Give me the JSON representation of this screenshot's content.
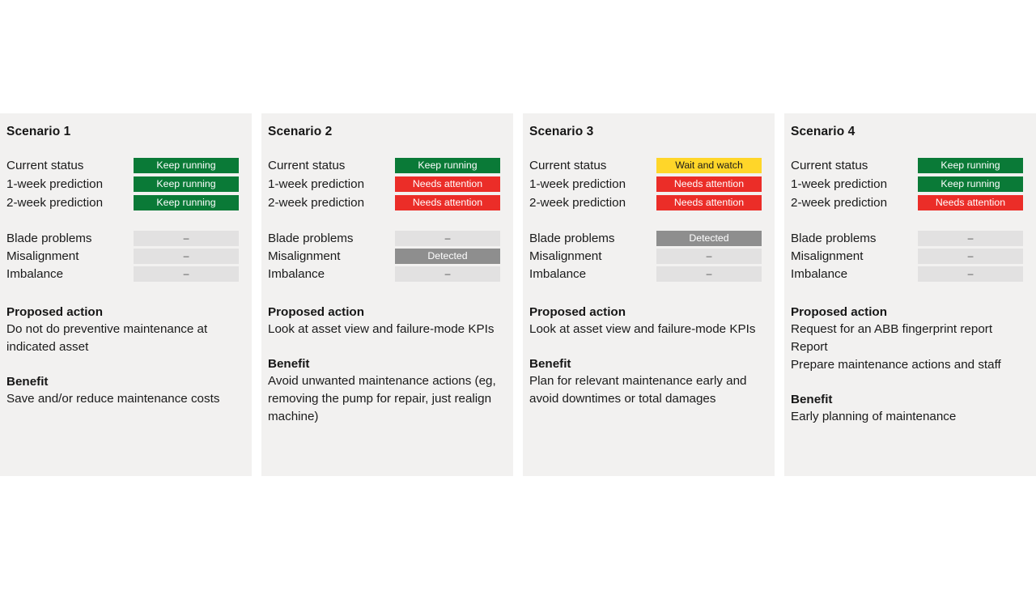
{
  "labels": {
    "status_rows": [
      "Current status",
      "1-week prediction",
      "2-week prediction"
    ],
    "fault_rows": [
      "Blade problems",
      "Misalignment",
      "Imbalance"
    ],
    "proposed_action_heading": "Proposed action",
    "benefit_heading": "Benefit"
  },
  "colors": {
    "keep_running": "#0a7a37",
    "needs_attention": "#eb2d28",
    "wait_and_watch": "#ffd629",
    "detected": "#8e8e8e",
    "none": "#e2e1e1",
    "card_background": "#f2f1f0",
    "page_background": "#ffffff"
  },
  "cards": [
    {
      "title": "Scenario 1",
      "status": [
        {
          "label": "Current status",
          "value": "Keep running",
          "state": "green"
        },
        {
          "label": "1-week prediction",
          "value": "Keep running",
          "state": "green"
        },
        {
          "label": "2-week prediction",
          "value": "Keep running",
          "state": "green"
        }
      ],
      "faults": [
        {
          "label": "Blade problems",
          "value": "–",
          "state": "gray"
        },
        {
          "label": "Misalignment",
          "value": "–",
          "state": "gray"
        },
        {
          "label": "Imbalance",
          "value": "–",
          "state": "gray"
        }
      ],
      "proposed_action_heading": "Proposed action",
      "proposed_action": "Do not do preventive maintenance at indicated asset",
      "benefit_heading": "Benefit",
      "benefit": "Save and/or reduce maintenance costs"
    },
    {
      "title": "Scenario 2",
      "status": [
        {
          "label": "Current status",
          "value": "Keep running",
          "state": "green"
        },
        {
          "label": "1-week prediction",
          "value": "Needs attention",
          "state": "red"
        },
        {
          "label": "2-week prediction",
          "value": "Needs attention",
          "state": "red"
        }
      ],
      "faults": [
        {
          "label": "Blade problems",
          "value": "–",
          "state": "gray"
        },
        {
          "label": "Misalignment",
          "value": "Detected",
          "state": "darkgray"
        },
        {
          "label": "Imbalance",
          "value": "–",
          "state": "gray"
        }
      ],
      "proposed_action_heading": "Proposed action",
      "proposed_action": "Look at asset view and failure-mode KPIs",
      "benefit_heading": "Benefit",
      "benefit": "Avoid unwanted maintenance actions (eg, removing the pump for repair, just realign machine)"
    },
    {
      "title": "Scenario 3",
      "status": [
        {
          "label": "Current status",
          "value": "Wait and watch",
          "state": "yellow"
        },
        {
          "label": "1-week prediction",
          "value": "Needs attention",
          "state": "red"
        },
        {
          "label": "2-week prediction",
          "value": "Needs attention",
          "state": "red"
        }
      ],
      "faults": [
        {
          "label": "Blade problems",
          "value": "Detected",
          "state": "darkgray"
        },
        {
          "label": "Misalignment",
          "value": "–",
          "state": "gray"
        },
        {
          "label": "Imbalance",
          "value": "–",
          "state": "gray"
        }
      ],
      "proposed_action_heading": "Proposed action",
      "proposed_action": "Look at asset view and failure-mode KPIs",
      "benefit_heading": "Benefit",
      "benefit": "Plan for relevant maintenance early and avoid downtimes or total damages"
    },
    {
      "title": "Scenario 4",
      "status": [
        {
          "label": "Current status",
          "value": "Keep running",
          "state": "green"
        },
        {
          "label": "1-week prediction",
          "value": "Keep running",
          "state": "green"
        },
        {
          "label": "2-week prediction",
          "value": "Needs attention",
          "state": "red"
        }
      ],
      "faults": [
        {
          "label": "Blade problems",
          "value": "–",
          "state": "gray"
        },
        {
          "label": "Misalignment",
          "value": "–",
          "state": "gray"
        },
        {
          "label": "Imbalance",
          "value": "–",
          "state": "gray"
        }
      ],
      "proposed_action_heading": "Proposed action",
      "proposed_action": "Request for an ABB fingerprint report\nReport\nPrepare maintenance actions and staff",
      "benefit_heading": "Benefit",
      "benefit": "Early planning of maintenance"
    }
  ]
}
